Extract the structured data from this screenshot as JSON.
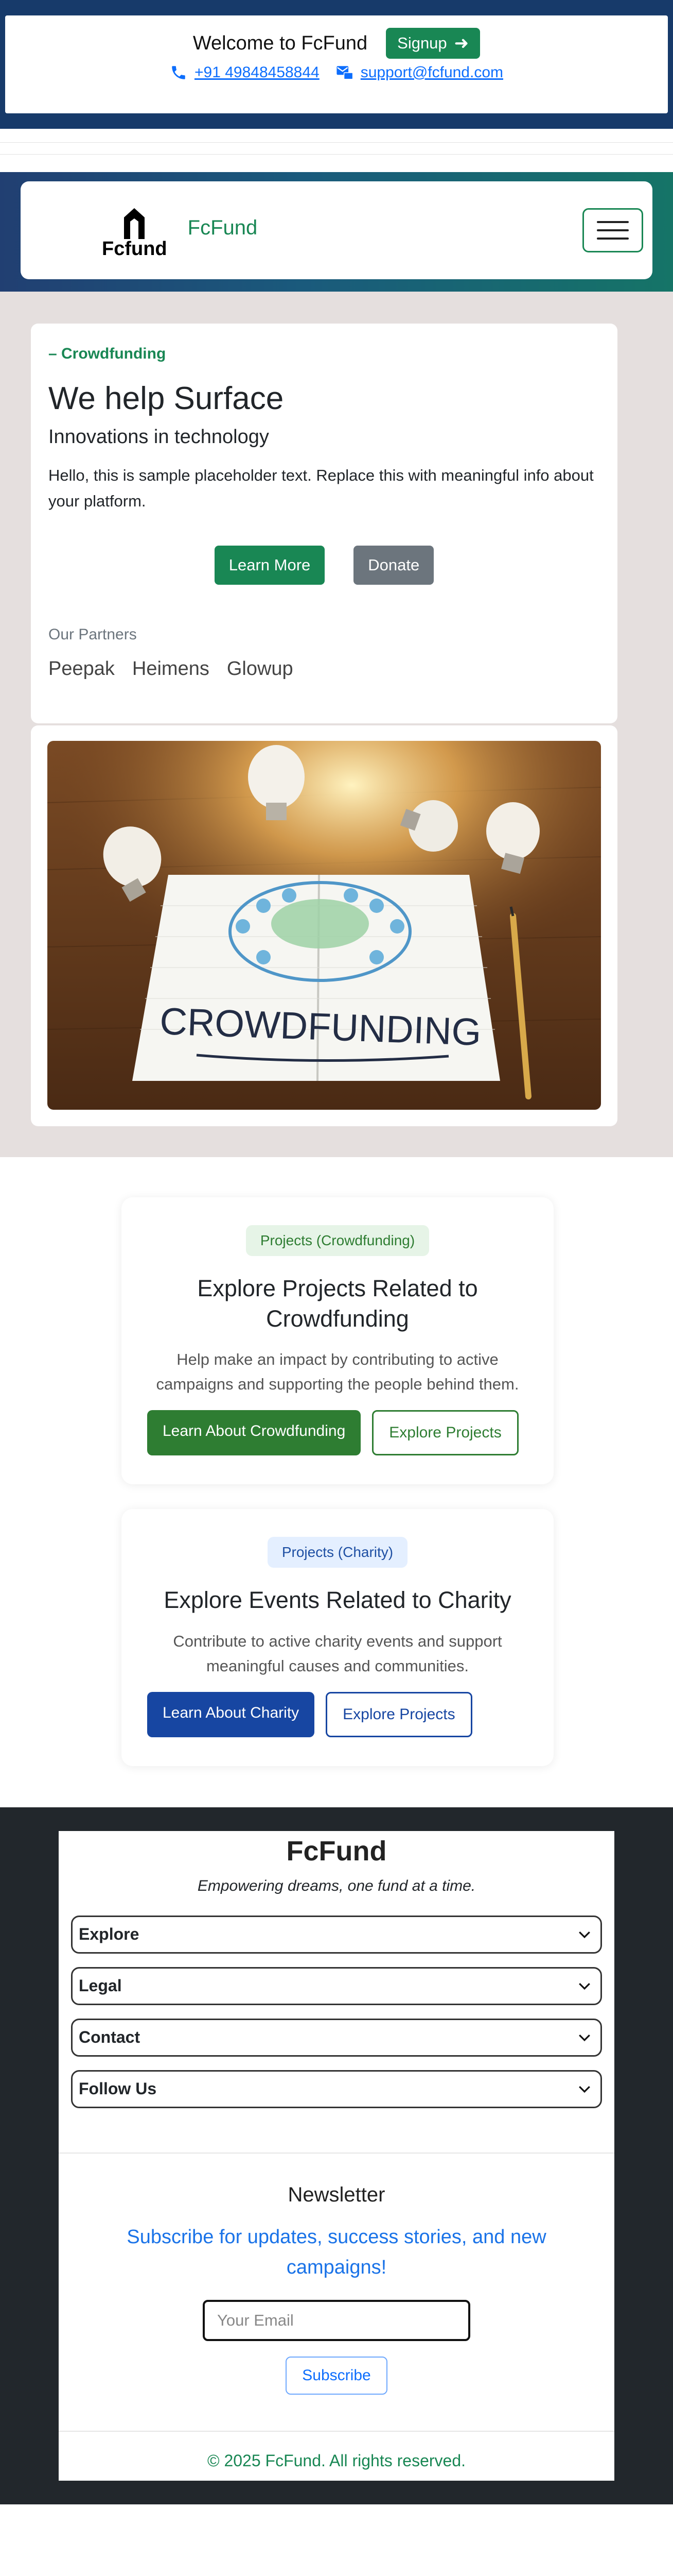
{
  "topbar": {
    "welcome": "Welcome to FcFund",
    "signup_label": "Signup",
    "phone": "+91 49848458844",
    "email": "support@fcfund.com"
  },
  "navbar": {
    "logo_text": "Fcfund",
    "brand_name": "FcFund"
  },
  "hero": {
    "eyebrow": "– Crowdfunding",
    "title": "We help Surface",
    "subtitle": "Innovations in technology",
    "body": "Hello, this is sample placeholder text. Replace this with meaningful info about your platform.",
    "learn_more": "Learn More",
    "donate": "Donate",
    "partners_label": "Our Partners",
    "partners": [
      "Peepak",
      "Heimens",
      "Glowup"
    ],
    "image_text": "CROWDFUNDING"
  },
  "projects": [
    {
      "badge": "Projects (Crowdfunding)",
      "title": "Explore Projects Related to Crowdfunding",
      "desc": "Help make an impact by contributing to active campaigns and supporting the people behind them.",
      "primary": "Learn About Crowdfunding",
      "secondary": "Explore Projects"
    },
    {
      "badge": "Projects (Charity)",
      "title": "Explore Events Related to Charity",
      "desc": "Contribute to active charity events and support meaningful causes and communities.",
      "primary": "Learn About Charity",
      "secondary": "Explore Projects"
    }
  ],
  "footer": {
    "brand": "FcFund",
    "tagline": "Empowering dreams, one fund at a time.",
    "accordions": [
      "Explore",
      "Legal",
      "Contact",
      "Follow Us"
    ],
    "newsletter_title": "Newsletter",
    "newsletter_sub": "Subscribe for updates, success stories, and new campaigns!",
    "email_placeholder": "Your Email",
    "subscribe": "Subscribe",
    "copyright": "© 2025 FcFund. All rights reserved."
  },
  "colors": {
    "topbar_bg": "#173a6a",
    "brand_green": "#198754",
    "hero_bg": "#e5dfde",
    "link_blue": "#0d6efd",
    "footer_bg": "#22272c"
  }
}
